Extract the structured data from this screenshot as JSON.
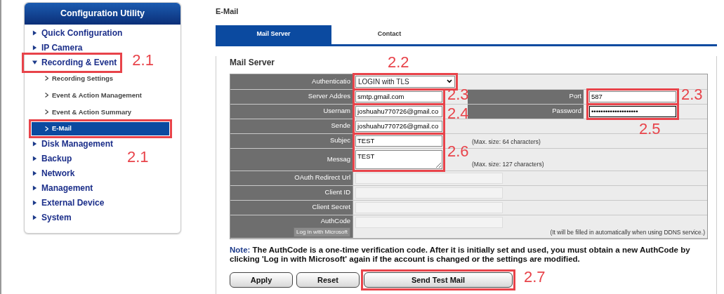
{
  "sidebar": {
    "title": "Configuration Utility",
    "items": [
      {
        "label": "Quick Configuration",
        "expanded": false
      },
      {
        "label": "IP Camera",
        "expanded": false
      },
      {
        "label": "Recording & Event",
        "expanded": true,
        "children": [
          {
            "label": "Recording Settings",
            "selected": false
          },
          {
            "label": "Event & Action Management",
            "selected": false
          },
          {
            "label": "Event & Action Summary",
            "selected": false
          },
          {
            "label": "E-Mail",
            "selected": true
          }
        ]
      },
      {
        "label": "Disk Management",
        "expanded": false
      },
      {
        "label": "Backup",
        "expanded": false
      },
      {
        "label": "Network",
        "expanded": false
      },
      {
        "label": "Management",
        "expanded": false
      },
      {
        "label": "External Device",
        "expanded": false
      },
      {
        "label": "System",
        "expanded": false
      }
    ]
  },
  "page_title": "E-Mail",
  "tabs": [
    {
      "label": "Mail Server",
      "selected": true
    },
    {
      "label": "Contact",
      "selected": false
    }
  ],
  "section_title": "Mail Server",
  "form": [
    {
      "kind": "select",
      "label": "Authenticatio",
      "value": "LOGIN with TLS"
    },
    {
      "kind": "text",
      "label": "Server Addres",
      "value": "smtp.gmail.com",
      "side": {
        "kind": "text",
        "label": "Port",
        "value": "587"
      }
    },
    {
      "kind": "text",
      "label": "Usernam",
      "value": "joshuahu770726@gmail.co",
      "side": {
        "kind": "password",
        "label": "Password",
        "value": "••••••••••••••••••••"
      }
    },
    {
      "kind": "text",
      "label": "Sende",
      "value": "joshuahu770726@gmail.co"
    },
    {
      "kind": "text",
      "label": "Subjec",
      "value": "TEST",
      "hint": "(Max. size: 64 characters)"
    },
    {
      "kind": "textarea",
      "label": "Messag",
      "value": "TEST",
      "hint": "(Max. size: 127 characters)"
    },
    {
      "kind": "text",
      "label": "OAuth Redirect Url",
      "disabled": true
    },
    {
      "kind": "text",
      "label": "Client ID",
      "disabled": true
    },
    {
      "kind": "text",
      "label": "Client Secret",
      "disabled": true
    },
    {
      "kind": "authcode",
      "label": "AuthCode",
      "disabled": true,
      "button": "Log in with Microsoft",
      "hint": "(It will be filled in automatically when using DDNS service.)"
    }
  ],
  "note": {
    "label": "Note:",
    "text": "The AuthCode is a one-time verification code. After it is initially set and used, you must obtain a new AuthCode by clicking 'Log in with Microsoft' again if the account is changed or the settings are modified."
  },
  "buttons": [
    {
      "label": "Apply",
      "kind": "normal"
    },
    {
      "label": "Reset",
      "kind": "normal"
    },
    {
      "label": "Send Test Mail",
      "kind": "wide"
    }
  ],
  "annotations": [
    {
      "label": "2.1"
    },
    {
      "label": "2.1"
    },
    {
      "label": "2.2"
    },
    {
      "label": "2.3"
    },
    {
      "label": "2.4"
    },
    {
      "label": "2.6"
    },
    {
      "label": "2.3"
    },
    {
      "label": "2.5"
    },
    {
      "label": "2.7"
    }
  ]
}
